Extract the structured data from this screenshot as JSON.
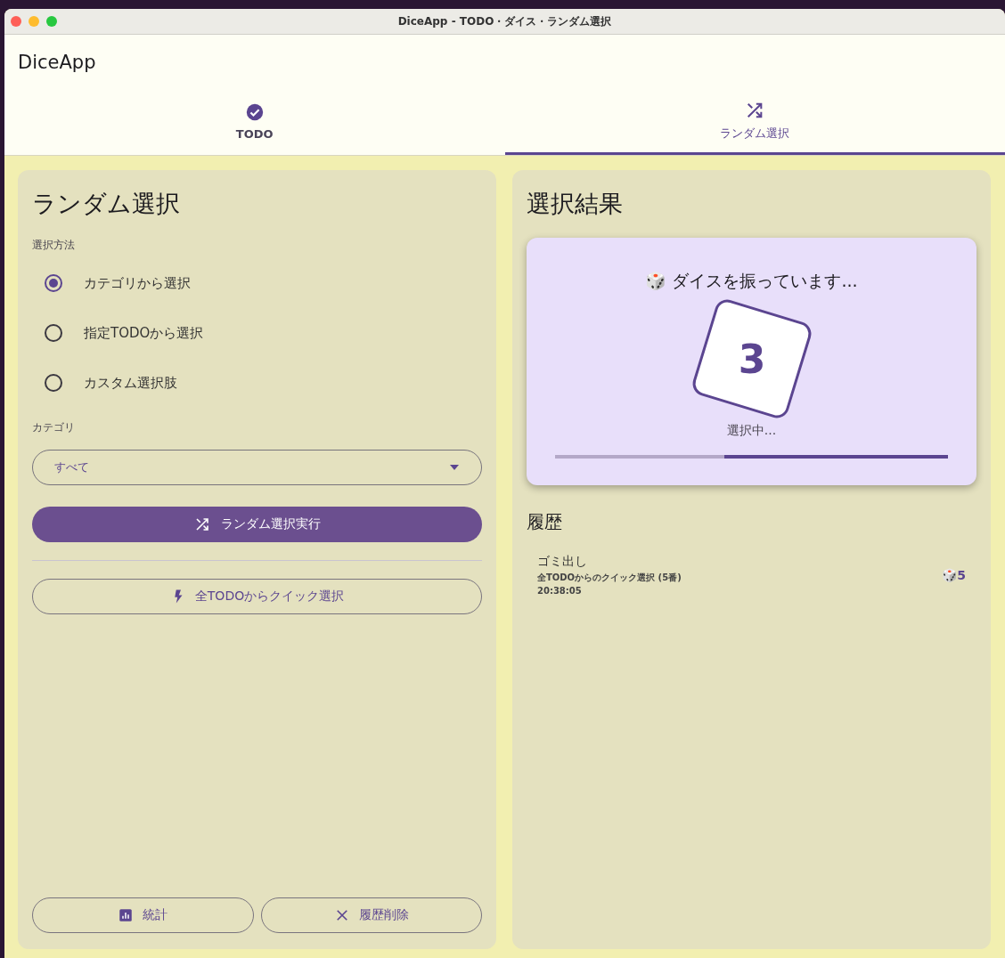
{
  "window": {
    "title": "DiceApp - TODO・ダイス・ランダム選択"
  },
  "app_bar": {
    "title": "DiceApp"
  },
  "tabs": [
    {
      "label": "TODO",
      "selected": false
    },
    {
      "label": "ランダム選択",
      "selected": true
    }
  ],
  "left_panel": {
    "title": "ランダム選択",
    "method_label": "選択方法",
    "methods": [
      {
        "label": "カテゴリから選択",
        "selected": true
      },
      {
        "label": "指定TODOから選択",
        "selected": false
      },
      {
        "label": "カスタム選択肢",
        "selected": false
      }
    ],
    "category_label": "カテゴリ",
    "category_value": "すべて",
    "run_button": "ランダム選択実行",
    "quick_button": "全TODOからクイック選択",
    "bottom_buttons": [
      {
        "label": "統計"
      },
      {
        "label": "履歴削除"
      }
    ]
  },
  "right_panel": {
    "title": "選択結果",
    "result_card": {
      "heading": "🎲 ダイスを振っています...",
      "dice_value": "3",
      "status": "選択中...",
      "level": 0.57
    },
    "history_title": "履歴",
    "history": [
      {
        "title": "ゴミ出し",
        "detail": "全TODOからのクイック選択 (5番)",
        "time": "20:38:05",
        "result": "🎲5"
      }
    ]
  }
}
